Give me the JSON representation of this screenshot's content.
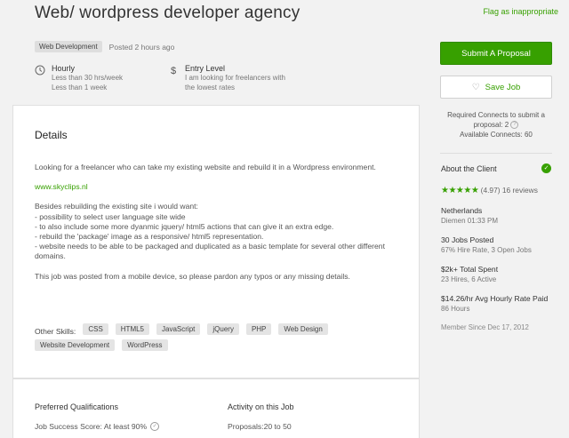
{
  "header": {
    "title": "Web/ wordpress developer agency",
    "flag_label": "Flag as inappropriate",
    "category": "Web Development",
    "posted": "Posted 2 hours ago"
  },
  "facts": [
    {
      "icon": "clock-icon",
      "title": "Hourly",
      "lines": [
        "Less than 30 hrs/week",
        "Less than 1 week"
      ]
    },
    {
      "icon": "dollar-icon",
      "title": "Entry Level",
      "lines": [
        "I am looking for freelancers with",
        "the lowest rates"
      ]
    }
  ],
  "details": {
    "heading": "Details",
    "intro": "Looking for a freelancer who can take my existing website and rebuild it in a Wordpress environment.",
    "link": "www.skyclips.nl",
    "wants_intro": "Besides rebuilding the existing site i would want:",
    "wants": [
      "- possibility to select user language site wide",
      "- to also include some more dyanmic jquery/ html5 actions that can give it an extra edge.",
      "- rebuild the 'package' image as a responsive/ html5 representation.",
      "- website needs to be able to be packaged and duplicated as a basic template for several other different domains."
    ],
    "mobile_note": "This job was posted from a mobile device, so please pardon any typos or any missing details."
  },
  "skills": {
    "label": "Other Skills:",
    "items": [
      "CSS",
      "HTML5",
      "JavaScript",
      "jQuery",
      "PHP",
      "Web Design",
      "Website Development",
      "WordPress"
    ]
  },
  "qualifications": {
    "heading": "Preferred Qualifications",
    "job_success": "Job Success Score: At least 90%"
  },
  "activity": {
    "heading": "Activity on this Job",
    "proposals": "Proposals:20 to 50"
  },
  "sidebar": {
    "submit_label": "Submit A Proposal",
    "save_label": "Save Job",
    "connects_required": "Required Connects to submit a proposal: 2",
    "connects_available": "Available Connects: 60",
    "client": {
      "heading": "About the Client",
      "rating": "(4.97) 16 reviews",
      "stars": 5,
      "country": "Netherlands",
      "city_time": "Diemen 01:33 PM",
      "jobs_posted": "30 Jobs Posted",
      "jobs_detail": "67% Hire Rate, 3 Open Jobs",
      "spent": "$2k+ Total Spent",
      "hires": "23 Hires, 6 Active",
      "hourly_rate": "$14.26/hr Avg Hourly Rate Paid",
      "hours": "86 Hours",
      "member_since": "Member Since Dec 17, 2012"
    }
  },
  "colors": {
    "accent": "#37a000",
    "background": "#f2f2f2"
  }
}
